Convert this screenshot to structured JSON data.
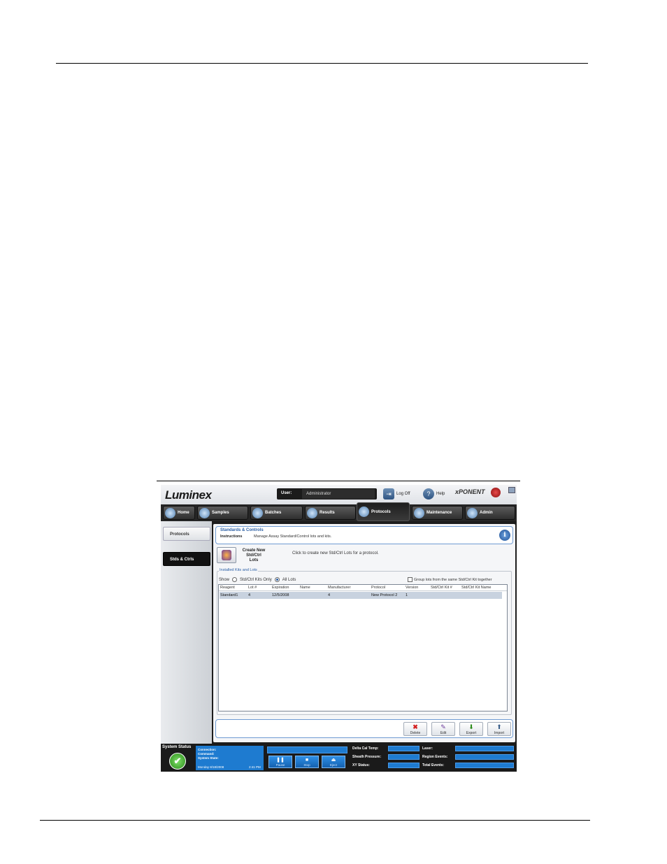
{
  "app": {
    "logo": "Luminex",
    "user_label": "User:",
    "user_value": "Administrator",
    "logoff_label": "Log Off",
    "help_label": "Help",
    "brand": "xPONENT"
  },
  "nav": {
    "tabs": [
      {
        "label": "Home",
        "icon": "home-icon"
      },
      {
        "label": "Samples",
        "icon": "samples-icon"
      },
      {
        "label": "Batches",
        "icon": "batches-icon"
      },
      {
        "label": "Results",
        "icon": "results-icon"
      },
      {
        "label": "Protocols",
        "icon": "protocols-icon",
        "active": true
      },
      {
        "label": "Maintenance",
        "icon": "maintenance-icon"
      },
      {
        "label": "Admin",
        "icon": "admin-icon"
      }
    ]
  },
  "sidebar": {
    "items": [
      {
        "label": "Protocols",
        "active": false
      },
      {
        "label": "Stds & Ctrls",
        "active": true
      }
    ]
  },
  "header": {
    "title": "Standards & Controls",
    "instructions_label": "Instructions",
    "instructions_text": "Manage Assay Standard/Control lots and kits."
  },
  "create": {
    "label_line1": "Create New Std/Ctrl",
    "label_line2": "Lots",
    "hint": "Click to create new Std/Ctrl Lots for a protocol."
  },
  "installed": {
    "title": "Installed Kits and Lots",
    "show_label": "Show",
    "option_kits_only": "Std/Ctrl Kits Only",
    "option_all_lots": "All Lots",
    "selected_option": "All Lots",
    "group_label": "Group lots from the same Std/Ctrl Kit together",
    "group_checked": false
  },
  "table": {
    "columns": [
      "Reagent",
      "Lot #",
      "Expiration",
      "Name",
      "Manufacturer",
      "Protocol",
      "Version",
      "Std/Ctrl Kit #",
      "Std/Ctrl Kit Name"
    ],
    "rows": [
      [
        "Standard1",
        "4",
        "12/5/2008",
        "",
        "4",
        "New Protocol 2",
        "1",
        "",
        ""
      ]
    ]
  },
  "footer_buttons": {
    "delete": "Delete",
    "edit": "Edit",
    "export": "Export",
    "import": "Import"
  },
  "status": {
    "system_status_label": "System Status",
    "connection_label": "Connection:",
    "command_label": "Command:",
    "system_state_label": "System State:",
    "date": "Monday 8/18/2008",
    "time": "2:41 PM",
    "pause_label": "Pause",
    "stop_label": "Stop",
    "eject_label": "Eject",
    "delta_cal_temp_label": "Delta Cal Temp:",
    "sheath_pressure_label": "Sheath Pressure:",
    "xy_status_label": "XY Status:",
    "laser_label": "Laser:",
    "region_events_label": "Region Events:",
    "total_events_label": "Total Events:"
  },
  "colors": {
    "accent_blue": "#1e7bd0",
    "header_blue": "#2b5fa5",
    "delete_red": "#d42020",
    "ok_green": "#2a8a18"
  }
}
